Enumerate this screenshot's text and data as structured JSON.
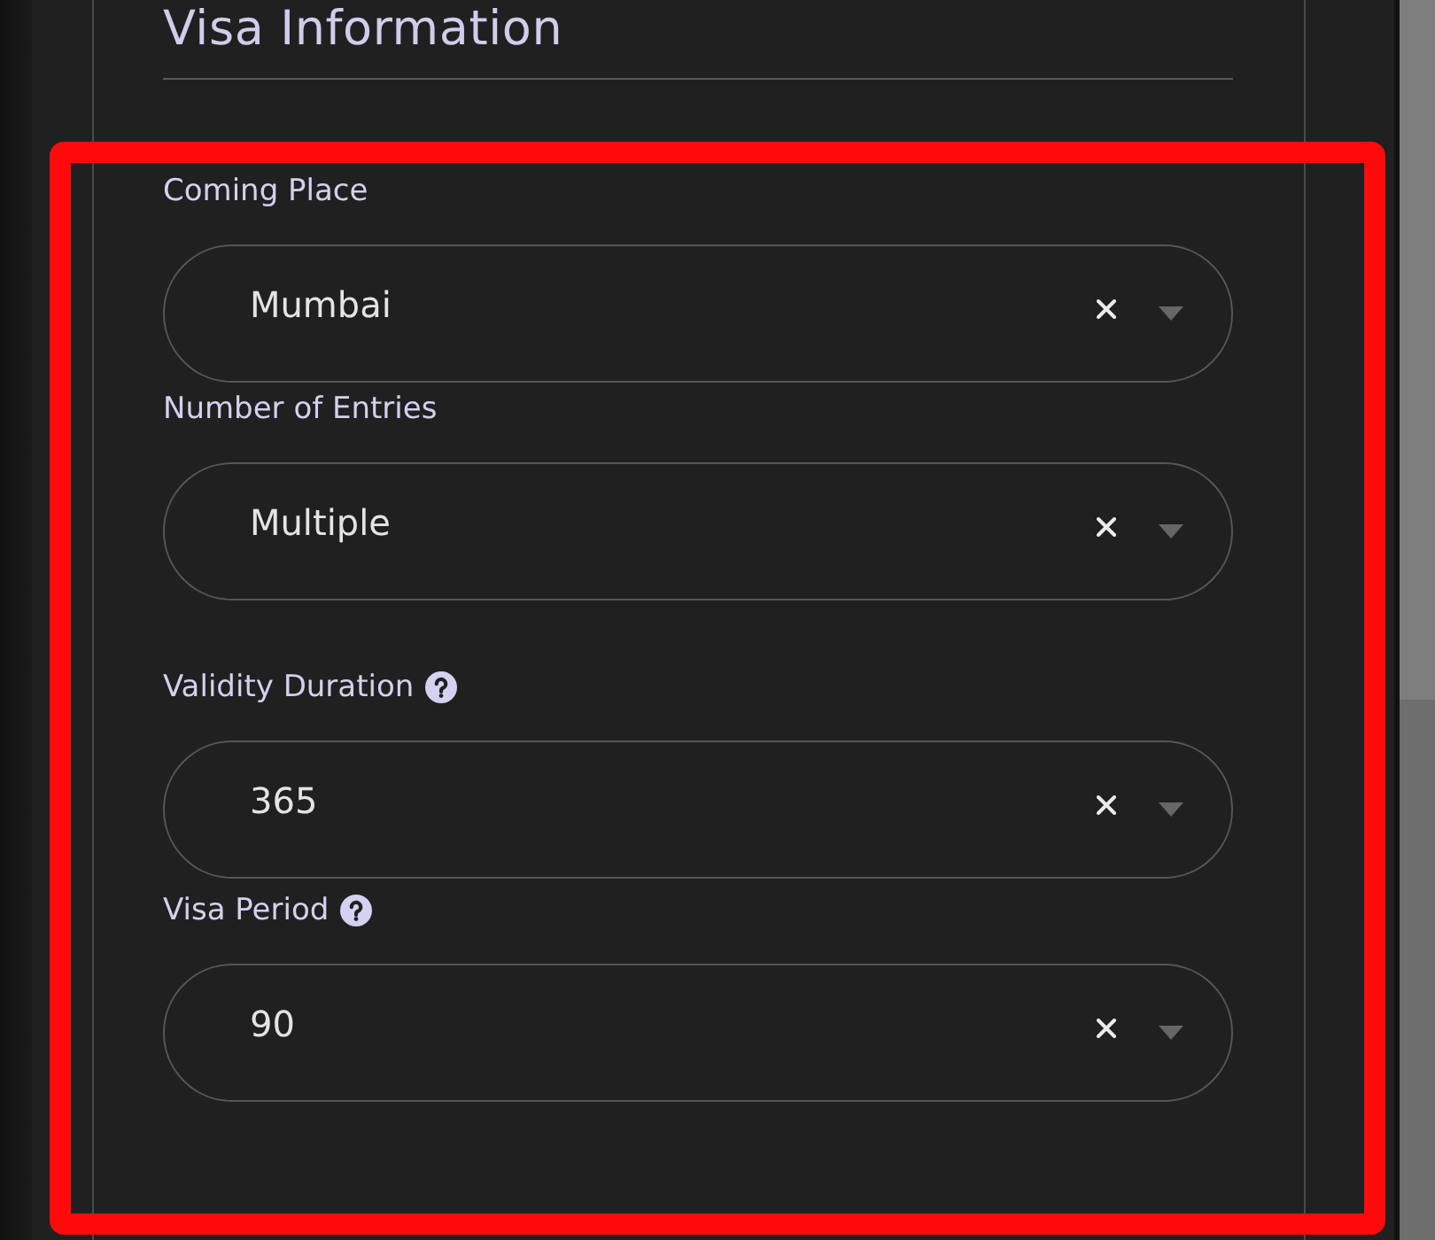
{
  "section": {
    "title": "Visa Information"
  },
  "fields": [
    {
      "label": "Coming Place",
      "help": false,
      "value": "Mumbai"
    },
    {
      "label": "Number of Entries",
      "help": false,
      "value": "Multiple"
    },
    {
      "label": "Validity Duration",
      "help": true,
      "value": "365"
    },
    {
      "label": "Visa Period",
      "help": true,
      "value": "90"
    }
  ],
  "highlight_frame": true
}
